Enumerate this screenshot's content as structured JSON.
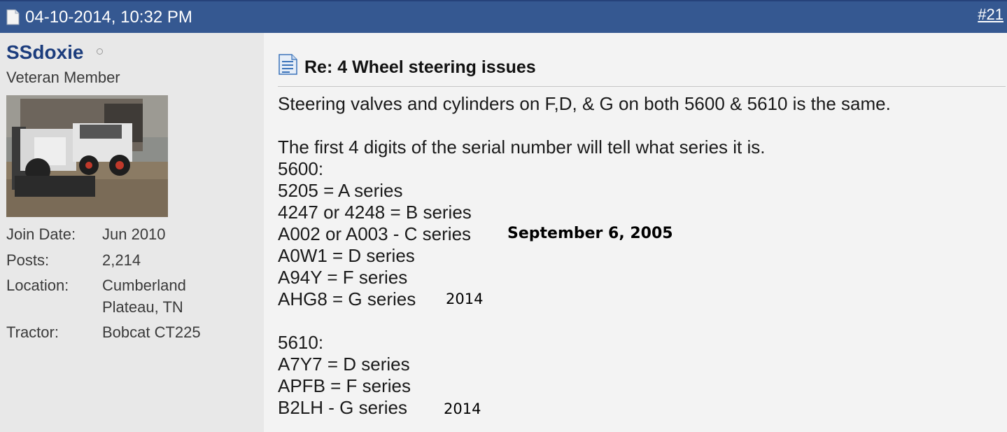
{
  "header": {
    "icon": "document-icon",
    "date": "04-10-2014, 10:32 PM",
    "post_number": "#21"
  },
  "user": {
    "name": "SSdoxie",
    "status_icon": "offline-status-icon",
    "title": "Veteran Member",
    "avatar": "avatar-photo",
    "stats": {
      "join_date_label": "Join Date:",
      "join_date": "Jun 2010",
      "posts_label": "Posts:",
      "posts": "2,214",
      "location_label": "Location:",
      "location_line1": "Cumberland",
      "location_line2": "Plateau, TN",
      "tractor_label": "Tractor:",
      "tractor": "Bobcat CT225"
    }
  },
  "post": {
    "icon": "post-document-icon",
    "title": "Re: 4 Wheel steering issues",
    "lines": [
      "Steering valves and cylinders on F,D, & G on both 5600 & 5610 is the same.",
      "The first 4 digits of the serial number will tell what series it is.",
      "5600:",
      "5205 = A series",
      "4247 or 4248 = B series",
      "A002 or A003 - C series",
      "A0W1 = D series",
      "A94Y = F series",
      "AHG8 = G series",
      "5610:",
      "A7Y7 = D series",
      "APFB = F series",
      "B2LH - G series"
    ],
    "annotations": {
      "c_series_date": "September 6, 2005",
      "g_series_year_5600": "2014",
      "g_series_year_5610": "2014"
    }
  }
}
